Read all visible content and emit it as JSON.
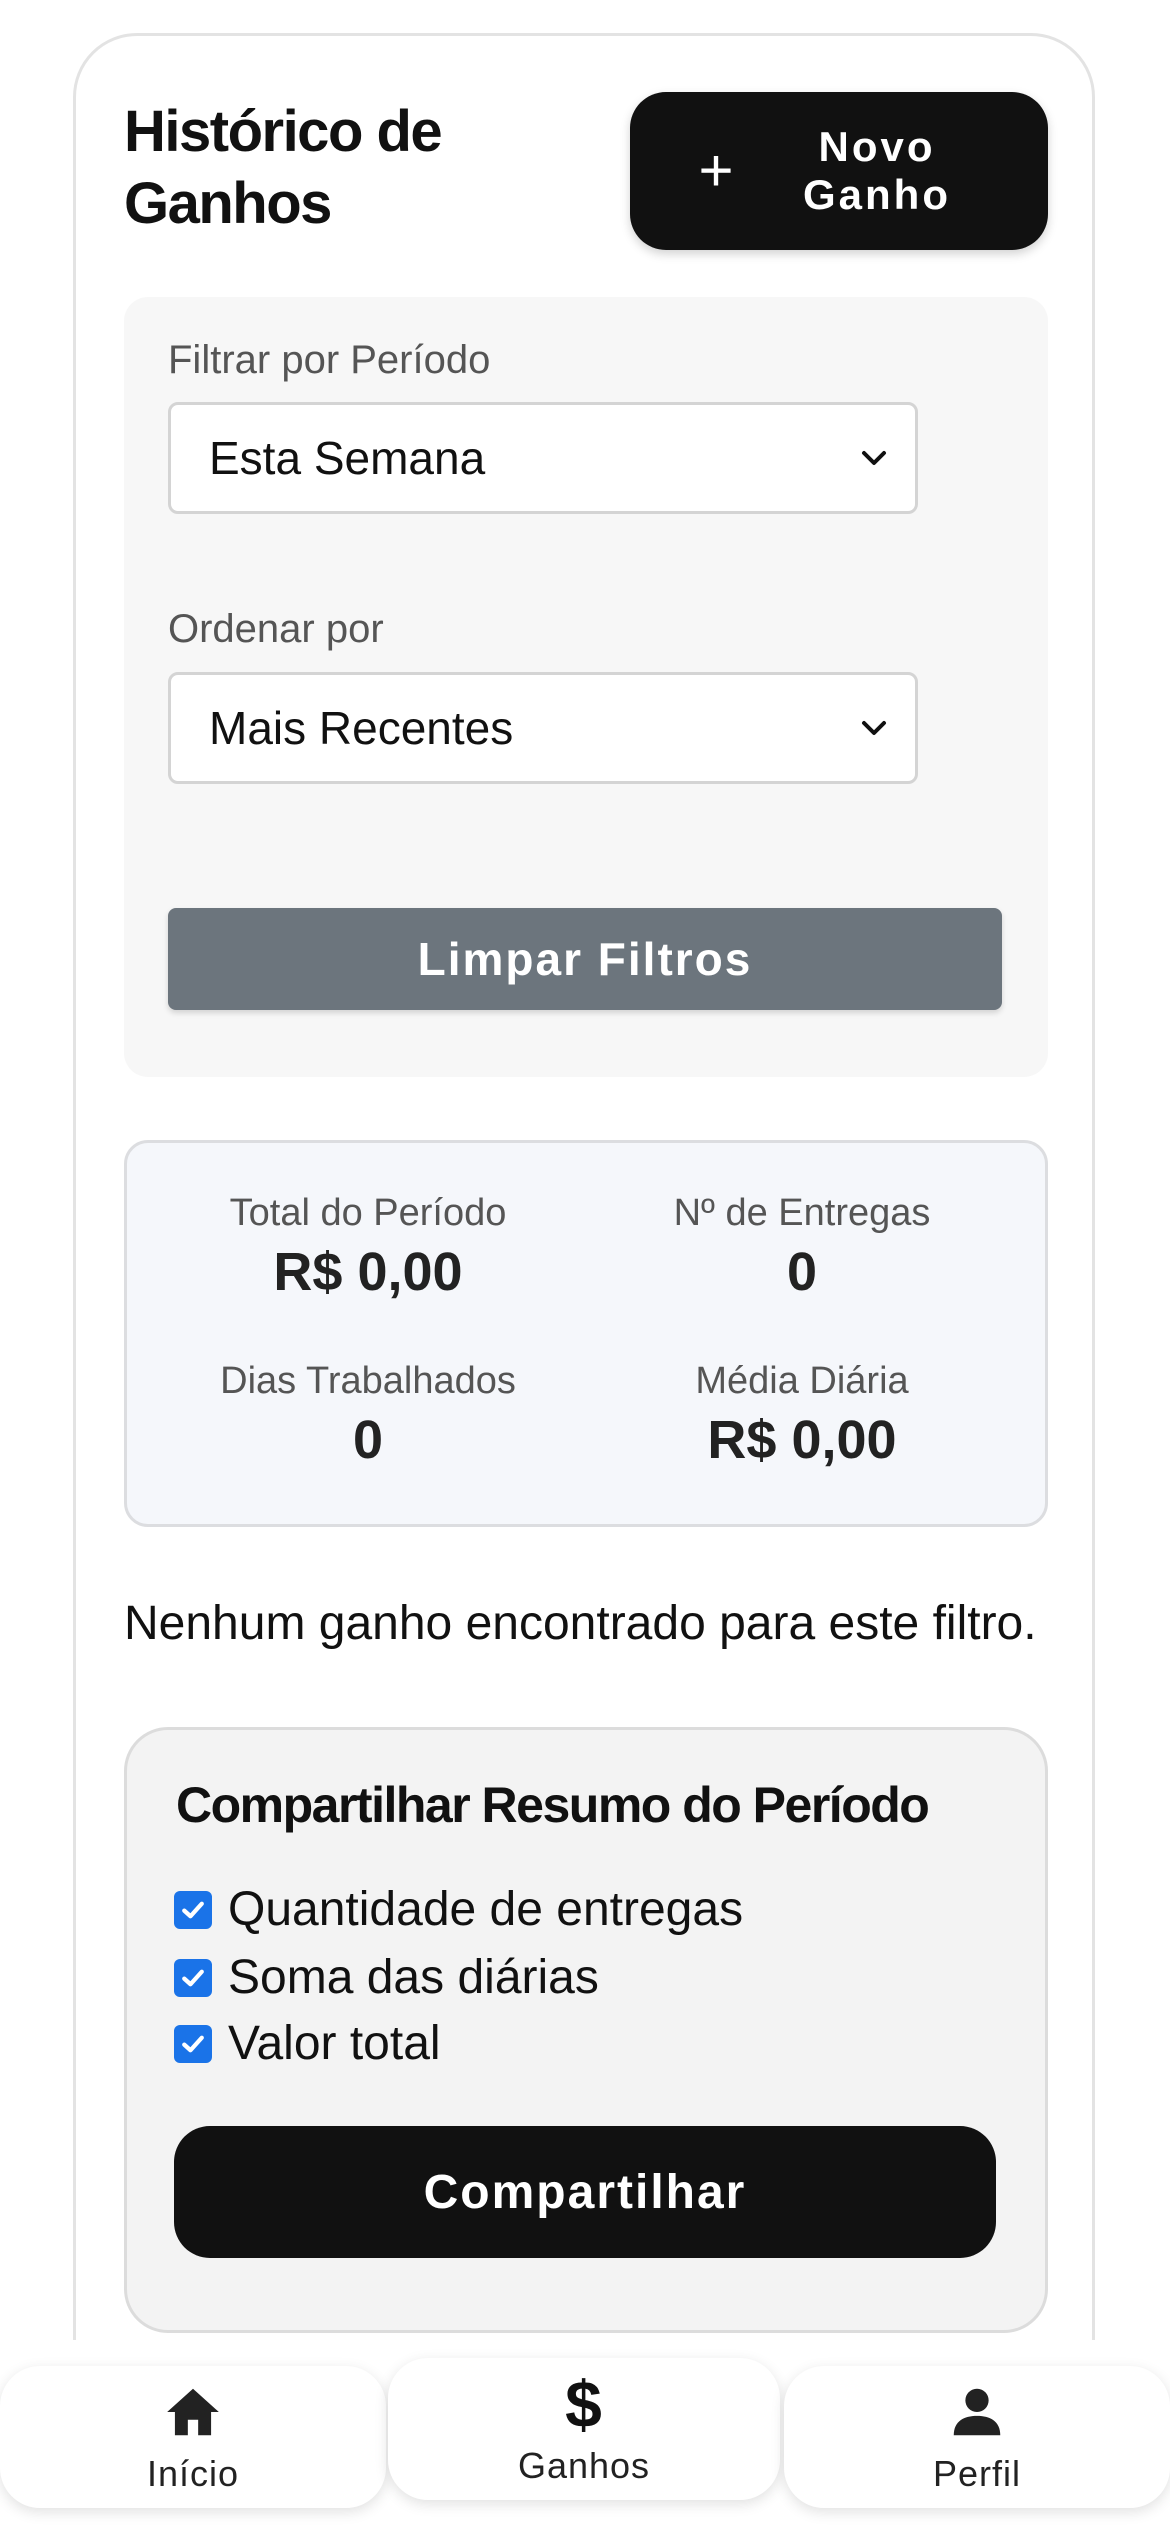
{
  "header": {
    "title": "Histórico de Ganhos",
    "new_button_plus": "+",
    "new_button_label": "Novo Ganho"
  },
  "filters": {
    "period_label": "Filtrar por Período",
    "period_value": "Esta Semana",
    "sort_label": "Ordenar por",
    "sort_value": "Mais Recentes",
    "clear_button": "Limpar Filtros"
  },
  "stats": {
    "total_label": "Total do Período",
    "total_value": "R$ 0,00",
    "deliveries_label": "Nº de Entregas",
    "deliveries_value": "0",
    "days_label": "Dias Trabalhados",
    "days_value": "0",
    "avg_label": "Média Diária",
    "avg_value": "R$ 0,00"
  },
  "empty_message": "Nenhum ganho encontrado para este filtro.",
  "share": {
    "title": "Compartilhar Resumo do Período",
    "options": [
      {
        "label": "Quantidade de entregas",
        "checked": true
      },
      {
        "label": "Soma das diárias",
        "checked": true
      },
      {
        "label": "Valor total",
        "checked": true
      }
    ],
    "button": "Compartilhar"
  },
  "bottom_nav": {
    "items": [
      {
        "label": "Início",
        "icon": "home-icon",
        "active": false
      },
      {
        "label": "Ganhos",
        "icon": "dollar-icon",
        "active": true
      },
      {
        "label": "Perfil",
        "icon": "person-icon",
        "active": false
      }
    ]
  },
  "colors": {
    "primary": "#111111",
    "secondary_button": "#6c757d",
    "checkbox": "#1a73e8",
    "stats_bg": "#f5f7fb"
  }
}
